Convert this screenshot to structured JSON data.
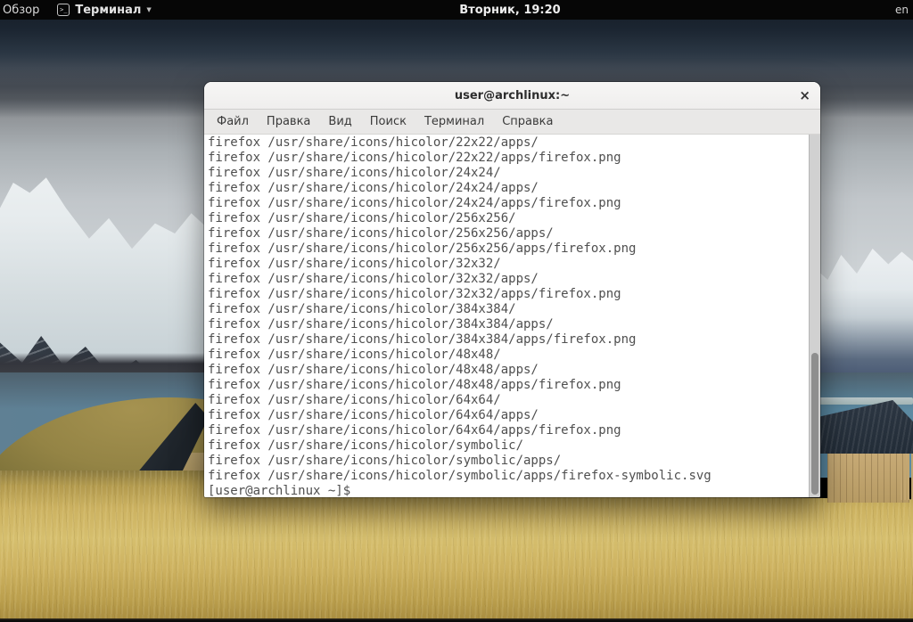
{
  "topbar": {
    "activities_label": "Обзор",
    "focused_app": {
      "icon_glyph": ">_",
      "label": "Терминал",
      "dropdown_glyph": "▼"
    },
    "clock": "Вторник, 19:20",
    "keyboard_layout": "en"
  },
  "window": {
    "title": "user@archlinux:~",
    "close_glyph": "×",
    "menubar": {
      "items": [
        {
          "label": "Файл"
        },
        {
          "label": "Правка"
        },
        {
          "label": "Вид"
        },
        {
          "label": "Поиск"
        },
        {
          "label": "Терминал"
        },
        {
          "label": "Справка"
        }
      ]
    },
    "terminal": {
      "output_lines": [
        "firefox /usr/share/icons/hicolor/22x22/apps/",
        "firefox /usr/share/icons/hicolor/22x22/apps/firefox.png",
        "firefox /usr/share/icons/hicolor/24x24/",
        "firefox /usr/share/icons/hicolor/24x24/apps/",
        "firefox /usr/share/icons/hicolor/24x24/apps/firefox.png",
        "firefox /usr/share/icons/hicolor/256x256/",
        "firefox /usr/share/icons/hicolor/256x256/apps/",
        "firefox /usr/share/icons/hicolor/256x256/apps/firefox.png",
        "firefox /usr/share/icons/hicolor/32x32/",
        "firefox /usr/share/icons/hicolor/32x32/apps/",
        "firefox /usr/share/icons/hicolor/32x32/apps/firefox.png",
        "firefox /usr/share/icons/hicolor/384x384/",
        "firefox /usr/share/icons/hicolor/384x384/apps/",
        "firefox /usr/share/icons/hicolor/384x384/apps/firefox.png",
        "firefox /usr/share/icons/hicolor/48x48/",
        "firefox /usr/share/icons/hicolor/48x48/apps/",
        "firefox /usr/share/icons/hicolor/48x48/apps/firefox.png",
        "firefox /usr/share/icons/hicolor/64x64/",
        "firefox /usr/share/icons/hicolor/64x64/apps/",
        "firefox /usr/share/icons/hicolor/64x64/apps/firefox.png",
        "firefox /usr/share/icons/hicolor/symbolic/",
        "firefox /usr/share/icons/hicolor/symbolic/apps/",
        "firefox /usr/share/icons/hicolor/symbolic/apps/firefox-symbolic.svg"
      ],
      "prompt": "[user@archlinux ~]$"
    }
  },
  "colors": {
    "topbar_bg": "#060606",
    "titlebar_bg": "#f4f3f2",
    "menubar_bg": "#e9e8e7",
    "terminal_bg": "#ffffff",
    "terminal_fg": "#4f4f4f",
    "water": "#55809a",
    "field": "#ccb261"
  }
}
